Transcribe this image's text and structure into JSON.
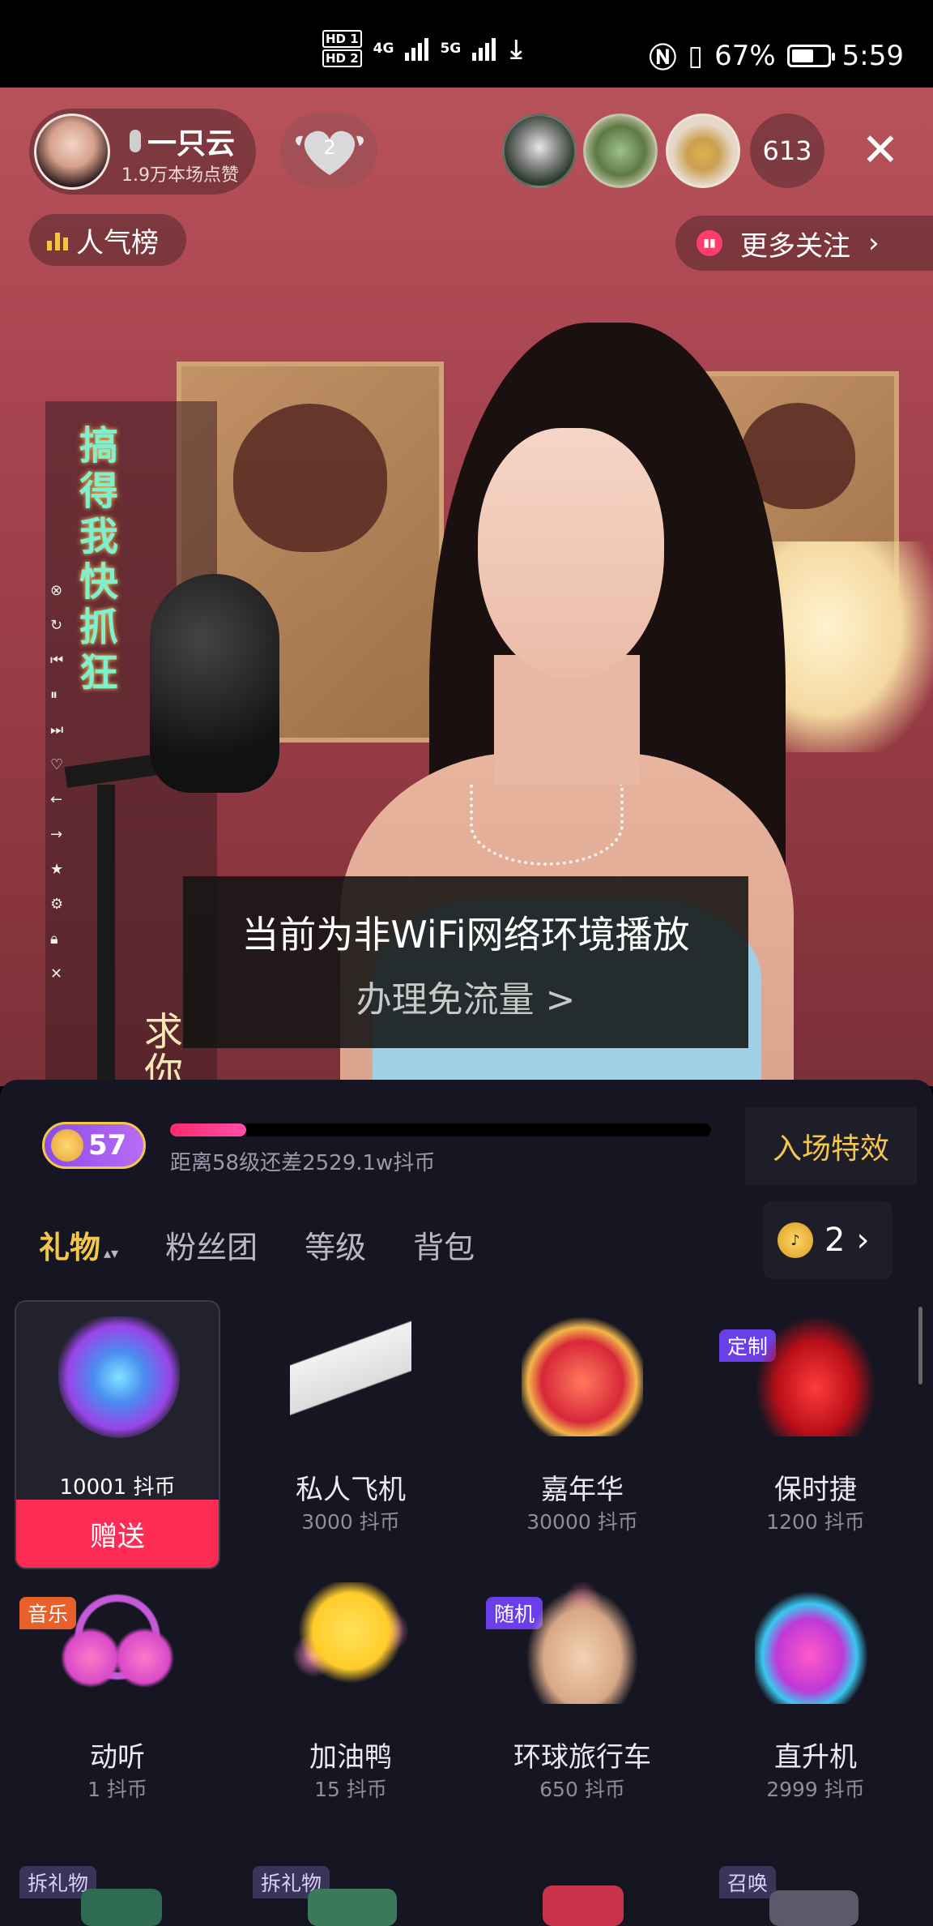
{
  "status_bar": {
    "sim1": "HD 1",
    "sim2": "HD 2",
    "net1": "4G",
    "net2": "5G",
    "battery_pct": "67%",
    "battery_level": 0.67,
    "time": "5:59"
  },
  "live": {
    "host_name": "一只云",
    "host_likes": "1.9万本场点赞",
    "like_count": "2",
    "viewer_count": "613",
    "rank_label": "人气榜",
    "more_follow_label": "更多关注",
    "side_title": "搞得我快抓狂",
    "side_bottom": "求你",
    "toast_title": "当前为非WiFi网络环境播放",
    "toast_link": "办理免流量 >"
  },
  "gift_panel": {
    "level": "57",
    "progress": 0.14,
    "progress_text": "距离58级还差2529.1w抖币",
    "entry_effect": "入场特效",
    "tabs": [
      "礼物",
      "粉丝团",
      "等级",
      "背包"
    ],
    "coin_balance": "2",
    "gifts": [
      {
        "name": "",
        "price": "10001 抖币",
        "tag": "",
        "icon": "rocket-gift-icon",
        "send": "赠送"
      },
      {
        "name": "私人飞机",
        "price": "3000 抖币",
        "tag": "",
        "icon": "private-jet-gift-icon"
      },
      {
        "name": "嘉年华",
        "price": "30000 抖币",
        "tag": "",
        "icon": "carnival-gift-icon"
      },
      {
        "name": "保时捷",
        "price": "1200 抖币",
        "tag": "定制",
        "icon": "porsche-gift-icon"
      },
      {
        "name": "动听",
        "price": "1 抖币",
        "tag": "音乐",
        "icon": "headphones-gift-icon"
      },
      {
        "name": "加油鸭",
        "price": "15 抖币",
        "tag": "",
        "icon": "duck-gift-icon"
      },
      {
        "name": "环球旅行车",
        "price": "650 抖币",
        "tag": "随机",
        "icon": "travel-car-gift-icon"
      },
      {
        "name": "直升机",
        "price": "2999 抖币",
        "tag": "",
        "icon": "helicopter-gift-icon"
      }
    ],
    "row3_tags": [
      "拆礼物",
      "拆礼物",
      "召唤"
    ]
  }
}
